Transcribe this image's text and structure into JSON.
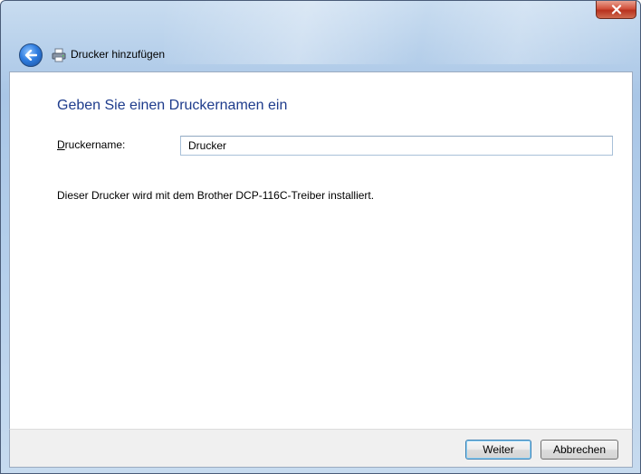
{
  "window": {
    "title": "Drucker hinzufügen",
    "close_icon": "close-icon",
    "back_icon": "back-arrow-icon",
    "printer_icon": "printer-icon"
  },
  "content": {
    "heading": "Geben Sie einen Druckernamen ein",
    "printer_name_label_accesskey": "D",
    "printer_name_label_rest": "ruckername:",
    "printer_name_value": "Drucker",
    "info_text": "Dieser Drucker wird mit dem Brother DCP-116C-Treiber installiert."
  },
  "footer": {
    "next_label": "Weiter",
    "cancel_label": "Abbrechen"
  },
  "colors": {
    "heading": "#1e3c8c",
    "title_bar": "#b6d0ec",
    "close_button": "#d2523d",
    "default_button_border": "#3c7fb1"
  }
}
